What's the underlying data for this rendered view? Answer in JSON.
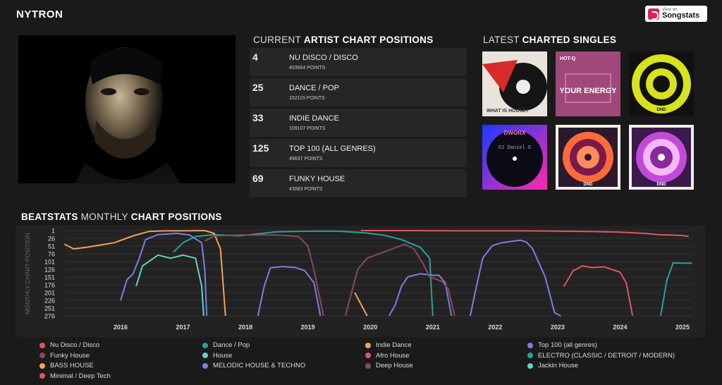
{
  "artist": {
    "name": "NYTRON"
  },
  "songstats": {
    "small": "View on",
    "big": "Songstats"
  },
  "current_positions": {
    "title_normal": "CURRENT ",
    "title_bold": "ARTIST CHART POSITIONS",
    "rows": [
      {
        "rank": "4",
        "genre": "NU DISCO / DISCO",
        "points": "403964 POINTS"
      },
      {
        "rank": "25",
        "genre": "DANCE / POP",
        "points": "152115 POINTS"
      },
      {
        "rank": "33",
        "genre": "INDIE DANCE",
        "points": "109107 POINTS"
      },
      {
        "rank": "125",
        "genre": "TOP 100 (ALL GENRES)",
        "points": "49637 POINTS"
      },
      {
        "rank": "69",
        "genre": "FUNKY HOUSE",
        "points": "43083 POINTS"
      }
    ]
  },
  "singles": {
    "title_normal": "LATEST ",
    "title_bold": "CHARTED SINGLES",
    "covers": [
      {
        "text": "WHAT IS HOUSE?"
      },
      {
        "text": "YOUR ENERGY",
        "small": "HOT-Q"
      },
      {
        "text": "DND"
      },
      {
        "text": "DJ Daniel G",
        "small": "DWORX"
      },
      {
        "text": "DND"
      },
      {
        "text": "DND"
      }
    ]
  },
  "monthly": {
    "title_bold1": "BEATSTATS",
    "title_normal": " MONTHLY ",
    "title_bold2": "CHART POSITIONS"
  },
  "chart_data": {
    "type": "line",
    "ylabel": "MONTHLY CHART POSITION",
    "y_ticks": [
      "1",
      "26",
      "51",
      "76",
      "101",
      "126",
      "151",
      "176",
      "201",
      "226",
      "251",
      "276"
    ],
    "y_reversed": true,
    "ylim": [
      1,
      276
    ],
    "x_ticks": [
      "2016",
      "2017",
      "2018",
      "2019",
      "2020",
      "2021",
      "2022",
      "2023",
      "2024",
      "2025"
    ],
    "xlim": [
      2015.1,
      2025.15
    ],
    "series": [
      {
        "name": "Nu Disco / Disco",
        "color": "#e0565f",
        "points": [
          [
            2019.85,
            1
          ],
          [
            2020.5,
            1
          ],
          [
            2021.5,
            2
          ],
          [
            2022.5,
            2
          ],
          [
            2023.5,
            4
          ],
          [
            2024.0,
            6
          ],
          [
            2024.4,
            10
          ],
          [
            2024.6,
            14
          ],
          [
            2024.8,
            15
          ],
          [
            2025.0,
            17
          ],
          [
            2025.1,
            20
          ]
        ]
      },
      {
        "name": "Dance / Pop",
        "color": "#2aa198",
        "points": [
          [
            2016.85,
            70
          ],
          [
            2017.0,
            40
          ],
          [
            2017.2,
            20
          ],
          [
            2017.5,
            14
          ],
          [
            2017.9,
            18
          ],
          [
            2018.5,
            5
          ],
          [
            2019.0,
            3
          ],
          [
            2019.5,
            3
          ],
          [
            2019.9,
            8
          ],
          [
            2020.2,
            15
          ],
          [
            2020.5,
            30
          ],
          [
            2020.8,
            55
          ],
          [
            2020.95,
            90
          ],
          [
            2021.0,
            276
          ]
        ]
      },
      {
        "name": "Indie Dance",
        "color": "#f5a05a",
        "points": [
          [
            2015.1,
            45
          ],
          [
            2015.25,
            60
          ],
          [
            2015.45,
            55
          ],
          [
            2015.6,
            50
          ],
          [
            2015.9,
            40
          ],
          [
            2016.2,
            18
          ],
          [
            2016.45,
            4
          ],
          [
            2016.7,
            2
          ],
          [
            2017.0,
            2
          ],
          [
            2017.35,
            1
          ],
          [
            2017.5,
            10
          ],
          [
            2017.6,
            60
          ],
          [
            2017.68,
            276
          ]
        ]
      },
      {
        "name": "Top 100 (all genres)",
        "color": "#7b7fe0",
        "points": [
          [
            2016.0,
            226
          ],
          [
            2016.1,
            160
          ],
          [
            2016.2,
            140
          ],
          [
            2016.3,
            90
          ],
          [
            2016.4,
            30
          ],
          [
            2016.6,
            14
          ],
          [
            2016.9,
            10
          ],
          [
            2017.1,
            15
          ],
          [
            2017.3,
            40
          ],
          [
            2017.35,
            130
          ],
          [
            2017.38,
            276
          ]
        ]
      },
      {
        "name": "Top 100 (all genres)",
        "color": "#7b7fe0",
        "points": [
          [
            2018.2,
            276
          ],
          [
            2018.3,
            180
          ],
          [
            2018.4,
            121
          ],
          [
            2018.6,
            117
          ],
          [
            2018.8,
            120
          ],
          [
            2018.95,
            130
          ],
          [
            2019.1,
            170
          ],
          [
            2019.2,
            276
          ]
        ]
      },
      {
        "name": "Top 100 (all genres)",
        "color": "#7b7fe0",
        "points": [
          [
            2020.3,
            276
          ],
          [
            2020.4,
            240
          ],
          [
            2020.5,
            180
          ],
          [
            2020.6,
            150
          ],
          [
            2020.7,
            145
          ],
          [
            2020.8,
            140
          ],
          [
            2021.0,
            145
          ],
          [
            2021.1,
            145
          ],
          [
            2021.2,
            170
          ],
          [
            2021.3,
            276
          ]
        ]
      },
      {
        "name": "Top 100 (all genres)",
        "color": "#7b7fe0",
        "points": [
          [
            2021.6,
            276
          ],
          [
            2021.7,
            180
          ],
          [
            2021.8,
            90
          ],
          [
            2021.95,
            50
          ],
          [
            2022.1,
            40
          ],
          [
            2022.4,
            32
          ],
          [
            2022.5,
            38
          ],
          [
            2022.6,
            60
          ],
          [
            2022.8,
            150
          ],
          [
            2022.95,
            265
          ],
          [
            2023.05,
            276
          ]
        ]
      },
      {
        "name": "Funky House",
        "color": "#8a4a5a",
        "points": [
          [
            2017.35,
            35
          ],
          [
            2017.5,
            18
          ],
          [
            2017.9,
            15
          ],
          [
            2018.5,
            15
          ],
          [
            2018.85,
            20
          ],
          [
            2019.0,
            50
          ],
          [
            2019.1,
            130
          ],
          [
            2019.25,
            276
          ]
        ]
      },
      {
        "name": "Afro House",
        "color": "#e0565f",
        "points": [
          [
            2023.1,
            181
          ],
          [
            2023.25,
            130
          ],
          [
            2023.4,
            115
          ],
          [
            2023.55,
            120
          ],
          [
            2023.75,
            118
          ],
          [
            2024.0,
            135
          ],
          [
            2024.1,
            170
          ],
          [
            2024.2,
            276
          ]
        ]
      },
      {
        "name": "ELECTRO (CLASSIC / DETROIT / MODERN)",
        "color": "#2aa198",
        "points": [
          [
            2024.65,
            276
          ],
          [
            2024.75,
            160
          ],
          [
            2024.85,
            105
          ],
          [
            2025.0,
            106
          ],
          [
            2025.15,
            106
          ]
        ]
      },
      {
        "name": "House",
        "color": "#5dd6c0",
        "points": [
          [
            2016.25,
            180
          ],
          [
            2016.35,
            115
          ],
          [
            2016.6,
            80
          ],
          [
            2016.8,
            90
          ],
          [
            2017.0,
            80
          ],
          [
            2017.2,
            90
          ],
          [
            2017.3,
            180
          ],
          [
            2017.33,
            276
          ]
        ]
      },
      {
        "name": "Deep House",
        "color": "#8a4a5a",
        "points": [
          [
            2019.6,
            276
          ],
          [
            2019.8,
            125
          ],
          [
            2019.95,
            90
          ],
          [
            2020.15,
            75
          ],
          [
            2020.35,
            60
          ],
          [
            2020.55,
            45
          ],
          [
            2020.7,
            60
          ],
          [
            2020.85,
            110
          ],
          [
            2020.95,
            150
          ],
          [
            2021.15,
            165
          ],
          [
            2021.25,
            190
          ],
          [
            2021.35,
            276
          ]
        ]
      },
      {
        "name": "Indie Dance",
        "color": "#f5a05a",
        "points": [
          [
            2019.75,
            201
          ],
          [
            2019.95,
            276
          ]
        ]
      }
    ]
  },
  "legend": [
    {
      "label": "Nu Disco / Disco",
      "color": "#e0565f"
    },
    {
      "label": "Dance / Pop",
      "color": "#2aa198"
    },
    {
      "label": "Indie Dance",
      "color": "#f5a05a"
    },
    {
      "label": "Top 100 (all genres)",
      "color": "#7b7fe0"
    },
    {
      "label": "Funky House",
      "color": "#8a4a5a"
    },
    {
      "label": "House",
      "color": "#5dd6c0"
    },
    {
      "label": "Afro House",
      "color": "#e0565f"
    },
    {
      "label": "ELECTRO (CLASSIC / DETROIT / MODERN)",
      "color": "#2aa198"
    },
    {
      "label": "BASS HOUSE",
      "color": "#f5a05a"
    },
    {
      "label": "MELODIC HOUSE & TECHNO",
      "color": "#7b7fe0"
    },
    {
      "label": "Deep House",
      "color": "#8a4a5a"
    },
    {
      "label": "Jackin House",
      "color": "#5dd6c0"
    },
    {
      "label": "Minimal / Deep Tech",
      "color": "#e0565f"
    }
  ]
}
